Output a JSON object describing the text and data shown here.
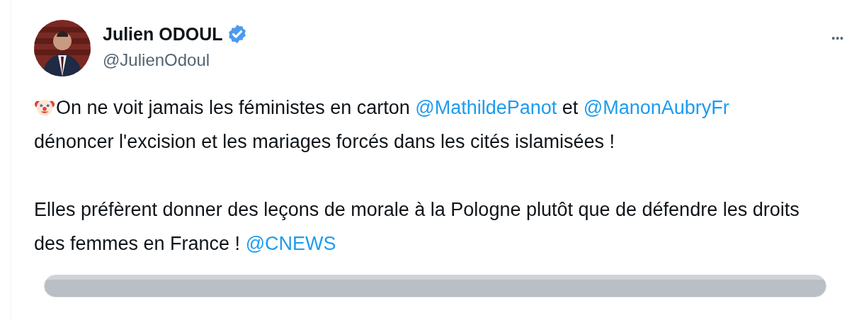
{
  "author": {
    "name": "Julien ODOUL",
    "verified": true,
    "handle": "@JulienOdoul"
  },
  "more_button": "•••",
  "body": [
    [
      {
        "kind": "emoji"
      },
      {
        "kind": "text",
        "text": "On ne voit jamais les féministes en carton "
      },
      {
        "kind": "mention",
        "text": "@MathildePanot"
      },
      {
        "kind": "text",
        "text": " et "
      },
      {
        "kind": "mention",
        "text": "@ManonAubryFr"
      },
      {
        "kind": "text",
        "text": " dénoncer l'excision et les mariages forcés dans les cités islamisées !"
      }
    ],
    [
      {
        "kind": "text",
        "text": "Elles préfèrent donner des leçons de morale à la Pologne plutôt que de défendre les droits des femmes en France ! "
      },
      {
        "kind": "mention",
        "text": "@CNEWS"
      }
    ]
  ]
}
